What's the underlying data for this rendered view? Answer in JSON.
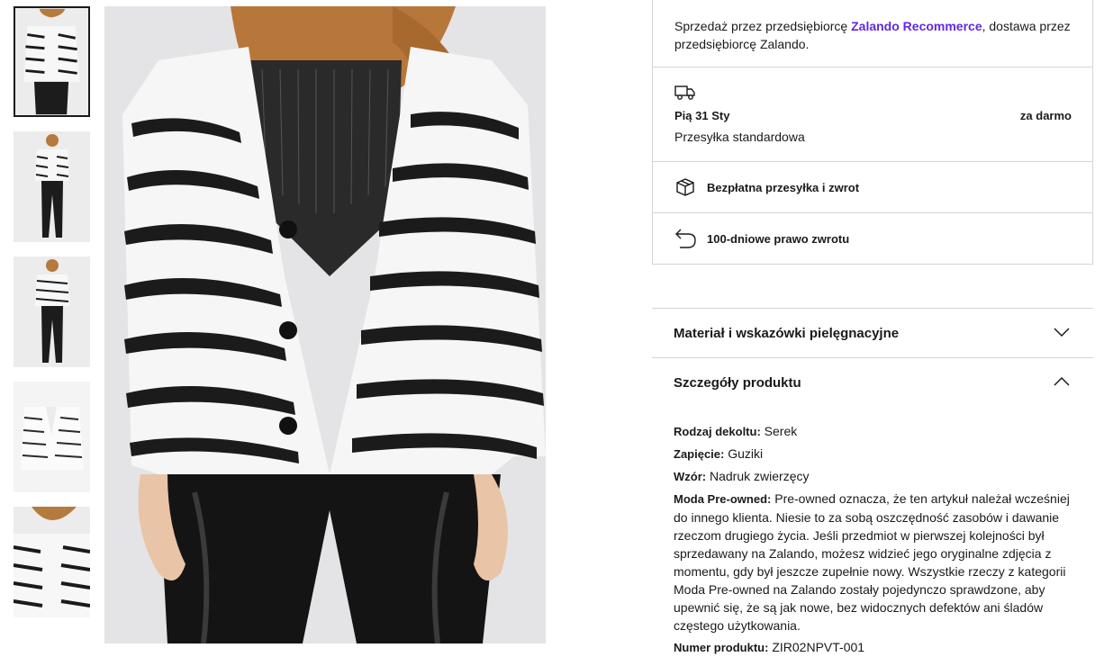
{
  "seller": {
    "prefix": "Sprzedaż przez przedsiębiorcę ",
    "company": "Zalando Recommerce",
    "suffix": ", dostawa przez przedsiębiorcę Zalando."
  },
  "delivery": {
    "date": "Pią 31 Sty",
    "price": "za darmo",
    "method": "Przesyłka standardowa",
    "icon": "truck-icon"
  },
  "benefits": [
    {
      "label": "Bezpłatna przesyłka i zwrot",
      "icon": "box-icon"
    },
    {
      "label": "100-dniowe prawo zwrotu",
      "icon": "return-arrow-icon"
    }
  ],
  "accordion": {
    "material_title": "Materiał i wskazówki pielęgnacyjne",
    "details_title": "Szczegóły produktu"
  },
  "details": {
    "neckline_label": "Rodzaj dekoltu:",
    "neckline_value": "Serek",
    "closure_label": "Zapięcie:",
    "closure_value": "Guziki",
    "pattern_label": "Wzór:",
    "pattern_value": "Nadruk zwierzęcy",
    "preowned_label": "Moda Pre-owned:",
    "preowned_value": "Pre-owned oznacza, że ten artykuł należał wcześniej do innego klienta. Niesie to za sobą oszczędność zasobów i dawanie rzeczom drugiego życia. Jeśli przedmiot w pierwszej kolejności był sprzedawany na Zalando, możesz widzieć jego oryginalne zdjęcia z momentu, gdy był jeszcze zupełnie nowy. Wszystkie rzeczy z kategorii Moda Pre-owned na Zalando zostały pojedynczo sprawdzone, aby upewnić się, że są jak nowe, bez widocznych defektów ani śladów częstego użytkowania.",
    "sku_label": "Numer produktu:",
    "sku_value": "ZIR02NPVT-001"
  },
  "colors": {
    "accent": "#6328e0",
    "border": "#d4d4d4",
    "text": "#1a1a1a"
  }
}
